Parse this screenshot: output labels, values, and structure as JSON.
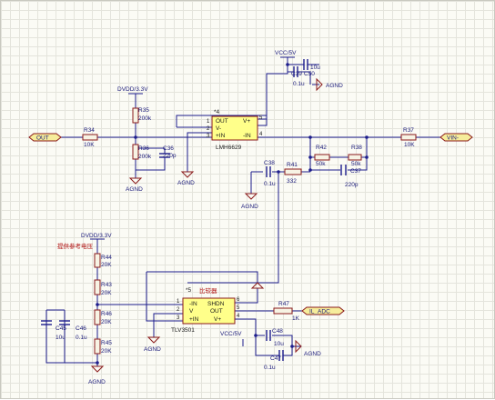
{
  "nets": {
    "dvdd_top": "DVDD/3.3V",
    "dvdd_bottom": "DVDD/3.3V",
    "vcc_top": "VCC/5V",
    "vcc_bottom": "VCC/5V",
    "agnd": "AGND"
  },
  "ports": {
    "out": "OUT",
    "vin": "VIN-",
    "il_adc": "IL_ADC"
  },
  "labels": {
    "ref_note": "提供参考电压",
    "comparator_note": "比较器"
  },
  "u4": {
    "designator": "*4",
    "part": "LMH6629",
    "pin_out": "OUT",
    "pin_vplus": "V+",
    "pin_vminus": "V-",
    "pin_inp": "+IN",
    "pin_inn": "-IN",
    "n1": "1",
    "n2": "2",
    "n3": "3",
    "n4": "4",
    "n5": "5"
  },
  "u5": {
    "designator": "*5",
    "part": "TLV3501",
    "pin_inn": "-IN",
    "pin_v": "V",
    "pin_inp": "+IN",
    "pin_shdn": "SHDN",
    "pin_out": "OUT",
    "pin_vplus": "V+",
    "n1": "1",
    "n2": "2",
    "n3": "3",
    "n4": "4",
    "n5": "5",
    "n6": "6"
  },
  "parts": {
    "R34": {
      "ref": "R34",
      "value": "10K"
    },
    "R35": {
      "ref": "R35",
      "value": "200k"
    },
    "R36": {
      "ref": "R36",
      "value": "200k"
    },
    "C36": {
      "ref": "C36",
      "value": "220p"
    },
    "C39": {
      "ref": "C39",
      "value": "0.1u"
    },
    "C50": {
      "ref": "C50",
      "value": "10u"
    },
    "R42": {
      "ref": "R42",
      "value": "50k"
    },
    "R38": {
      "ref": "R38",
      "value": "50k"
    },
    "R37": {
      "ref": "R37",
      "value": "10K"
    },
    "C38": {
      "ref": "C38",
      "value": "0.1u"
    },
    "R41": {
      "ref": "R41",
      "value": "332"
    },
    "C37": {
      "ref": "C37",
      "value": "220p"
    },
    "R44": {
      "ref": "R44",
      "value": "20K"
    },
    "R43": {
      "ref": "R43",
      "value": "20K"
    },
    "R46": {
      "ref": "R46",
      "value": "20K"
    },
    "R45": {
      "ref": "R45",
      "value": "20K"
    },
    "C45": {
      "ref": "C45",
      "value": "10u"
    },
    "C46": {
      "ref": "C46",
      "value": "0.1u"
    },
    "R47": {
      "ref": "R47",
      "value": "1K"
    },
    "C48": {
      "ref": "C48",
      "value": "10u"
    },
    "C47": {
      "ref": "C47",
      "value": "0.1u"
    }
  }
}
